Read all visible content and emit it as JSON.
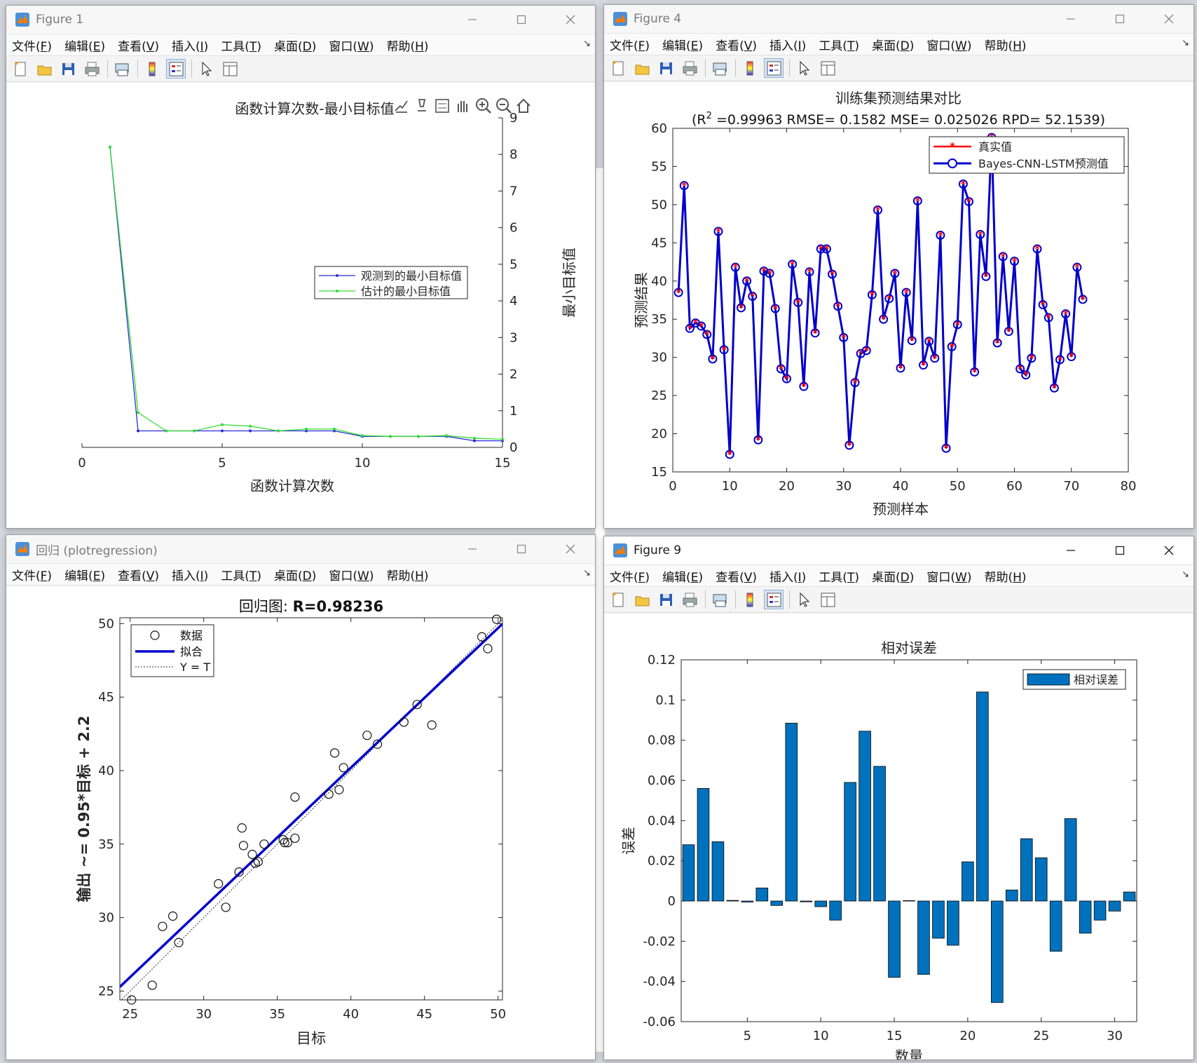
{
  "menus": [
    {
      "label": "文件(",
      "acc": "F",
      "tail": ")"
    },
    {
      "label": "编辑(",
      "acc": "E",
      "tail": ")"
    },
    {
      "label": "查看(",
      "acc": "V",
      "tail": ")"
    },
    {
      "label": "插入(",
      "acc": "I",
      "tail": ")"
    },
    {
      "label": "工具(",
      "acc": "T",
      "tail": ")"
    },
    {
      "label": "桌面(",
      "acc": "D",
      "tail": ")"
    },
    {
      "label": "窗口(",
      "acc": "W",
      "tail": ")"
    },
    {
      "label": "帮助(",
      "acc": "H",
      "tail": ")"
    }
  ],
  "windows": {
    "fig1": {
      "title": "Figure 1"
    },
    "fig4": {
      "title": "Figure 4"
    },
    "reg": {
      "title": "回归 (plotregression)"
    },
    "fig9": {
      "title": "Figure 9"
    }
  },
  "chart_data": [
    {
      "id": "fig1",
      "type": "line",
      "title": "函数计算次数-最小目标值",
      "xlabel": "函数计算次数",
      "ylabel": "最小目标值",
      "xlim": [
        0,
        15
      ],
      "ylim": [
        0,
        9
      ],
      "xticks": [
        0,
        5,
        10,
        15
      ],
      "yticks": [
        0,
        1,
        2,
        3,
        4,
        5,
        6,
        7,
        8,
        9
      ],
      "legend_position": "center-right",
      "series": [
        {
          "name": "观测到的最小目标值",
          "color": "#2b2bd6",
          "x": [
            1,
            2,
            3,
            4,
            5,
            6,
            7,
            8,
            9,
            10,
            11,
            12,
            13,
            14,
            15
          ],
          "y": [
            8.2,
            0.45,
            0.45,
            0.45,
            0.45,
            0.45,
            0.45,
            0.45,
            0.45,
            0.3,
            0.3,
            0.3,
            0.3,
            0.18,
            0.18
          ]
        },
        {
          "name": "估计的最小目标值",
          "color": "#33dd33",
          "x": [
            1,
            2,
            3,
            4,
            5,
            6,
            7,
            8,
            9,
            10,
            11,
            12,
            13,
            14,
            15
          ],
          "y": [
            8.2,
            0.95,
            0.45,
            0.45,
            0.62,
            0.58,
            0.45,
            0.5,
            0.5,
            0.32,
            0.3,
            0.3,
            0.32,
            0.25,
            0.22
          ]
        }
      ]
    },
    {
      "id": "fig4",
      "type": "line",
      "title": "训练集预测结果对比",
      "subtitle_pre": "(R",
      "subtitle_sup": "2",
      "subtitle_post": " =0.99963 RMSE= 0.1582 MSE= 0.025026 RPD= 52.1539)",
      "xlabel": "预测样本",
      "ylabel": "预测结果",
      "xlim": [
        0,
        80
      ],
      "ylim": [
        15,
        60
      ],
      "xticks": [
        0,
        10,
        20,
        30,
        40,
        50,
        60,
        70,
        80
      ],
      "yticks": [
        15,
        20,
        25,
        30,
        35,
        40,
        45,
        50,
        55,
        60
      ],
      "legend_position": "top-right",
      "series": [
        {
          "name": "真实值",
          "color": "#ff0000",
          "marker": "star"
        },
        {
          "name": "Bayes-CNN-LSTM预测值",
          "color": "#0000cc",
          "marker": "circle"
        }
      ],
      "values": [
        38.5,
        52.5,
        33.8,
        34.5,
        34.1,
        33.0,
        29.8,
        46.5,
        31.0,
        17.3,
        41.8,
        36.5,
        40.0,
        38.0,
        19.2,
        41.3,
        41.0,
        36.4,
        28.5,
        27.2,
        42.2,
        37.2,
        26.2,
        41.2,
        33.2,
        44.2,
        44.2,
        40.9,
        36.7,
        32.6,
        18.5,
        26.7,
        30.5,
        30.9,
        38.2,
        49.3,
        35.0,
        37.7,
        41.0,
        28.6,
        38.5,
        32.2,
        50.5,
        29.0,
        32.1,
        29.9,
        46.0,
        18.1,
        31.4,
        34.3,
        52.7,
        50.4,
        28.1,
        46.1,
        40.6,
        58.8,
        31.9,
        43.2,
        33.4,
        42.6,
        28.5,
        27.7,
        29.9,
        44.2,
        36.9,
        35.2,
        26.0,
        29.7,
        35.7,
        30.1,
        41.8,
        37.6
      ]
    },
    {
      "id": "reg",
      "type": "scatter",
      "title_pre": "回归图: ",
      "title_bold": "R=0.98236",
      "xlabel": "目标",
      "ylabel": "输出 ~= 0.95*目标 + 2.2",
      "xlim": [
        24.3,
        50.3
      ],
      "ylim": [
        24.4,
        50.4
      ],
      "xticks": [
        25,
        30,
        35,
        40,
        45,
        50
      ],
      "yticks": [
        25,
        30,
        35,
        40,
        45,
        50
      ],
      "legend_position": "top-left",
      "legend": [
        "数据",
        "拟合",
        "Y = T"
      ],
      "fit": {
        "slope": 0.95,
        "intercept": 2.2
      },
      "x": [
        25.1,
        26.5,
        27.2,
        27.9,
        28.3,
        31.0,
        31.5,
        32.4,
        32.6,
        32.7,
        33.3,
        33.5,
        33.7,
        34.1,
        35.4,
        35.5,
        35.7,
        36.2,
        36.2,
        38.5,
        38.9,
        39.2,
        39.5,
        41.1,
        41.8,
        43.6,
        44.5,
        45.5,
        48.9,
        49.3,
        49.9
      ],
      "y": [
        24.4,
        25.4,
        29.4,
        30.1,
        28.3,
        32.3,
        30.7,
        33.1,
        36.1,
        34.9,
        34.3,
        33.7,
        33.8,
        35.0,
        35.3,
        35.1,
        35.1,
        38.2,
        35.4,
        38.4,
        41.2,
        38.7,
        40.2,
        42.4,
        41.8,
        43.3,
        44.5,
        43.1,
        49.1,
        48.3,
        50.3
      ]
    },
    {
      "id": "fig9",
      "type": "bar",
      "title": "相对误差",
      "xlabel": "数量",
      "ylabel": "误差",
      "xlim": [
        0.5,
        31.5
      ],
      "ylim": [
        -0.06,
        0.12
      ],
      "xticks": [
        5,
        10,
        15,
        20,
        25,
        30
      ],
      "yticks": [
        -0.06,
        -0.04,
        -0.02,
        0,
        0.02,
        0.04,
        0.06,
        0.08,
        0.1,
        0.12
      ],
      "legend_position": "top-right",
      "series_name": "相对误差",
      "color": "#0072bd",
      "categories": [
        1,
        2,
        3,
        4,
        5,
        6,
        7,
        8,
        9,
        10,
        11,
        12,
        13,
        14,
        15,
        16,
        17,
        18,
        19,
        20,
        21,
        22,
        23,
        24,
        25,
        26,
        27,
        28,
        29,
        30,
        31
      ],
      "values": [
        0.028,
        0.056,
        0.0295,
        0.0003,
        -0.0005,
        0.0065,
        -0.0022,
        0.0885,
        -0.0004,
        -0.0028,
        -0.0095,
        0.059,
        0.0845,
        0.067,
        -0.038,
        0.0002,
        -0.0365,
        -0.0185,
        -0.022,
        0.0195,
        0.104,
        -0.0505,
        0.0055,
        0.031,
        0.0215,
        -0.025,
        0.041,
        -0.016,
        -0.0095,
        -0.005,
        0.0045
      ]
    }
  ]
}
